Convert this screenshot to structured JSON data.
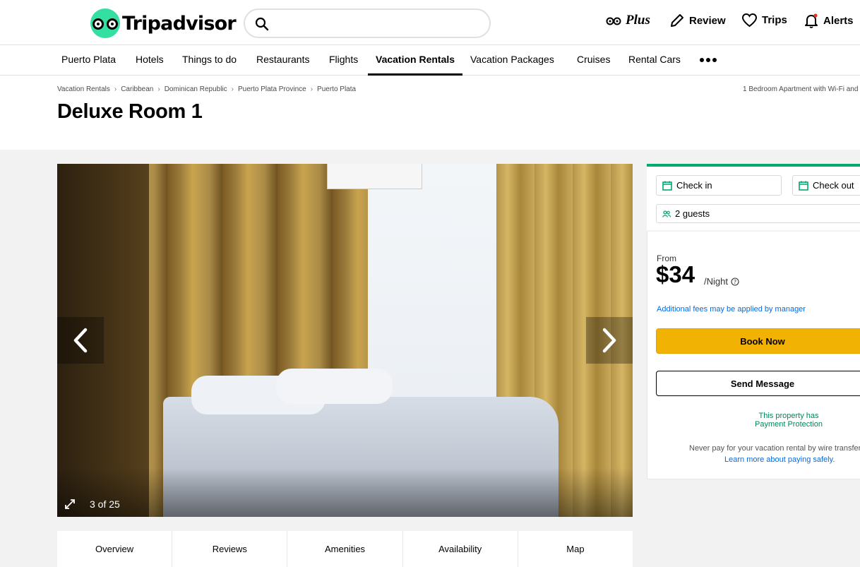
{
  "header": {
    "brand": "Tripadvisor",
    "search": {
      "placeholder": "",
      "value": ""
    },
    "plus_label": "Plus",
    "nav": [
      {
        "label": "Review",
        "icon": "pencil-icon"
      },
      {
        "label": "Trips",
        "icon": "heart-icon"
      },
      {
        "label": "Alerts",
        "icon": "bell-icon"
      }
    ]
  },
  "categories": {
    "items": [
      "Puerto Plata",
      "Hotels",
      "Things to do",
      "Restaurants",
      "Flights",
      "Vacation Rentals",
      "Vacation Packages",
      "Cruises",
      "Rental Cars"
    ],
    "active": "Vacation Rentals"
  },
  "breadcrumb": {
    "items": [
      "Vacation Rentals",
      "Caribbean",
      "Dominican Republic",
      "Puerto Plata Province",
      "Puerto Plata"
    ],
    "right_text": "1 Bedroom Apartment with Wi-Fi and"
  },
  "listing": {
    "title": "Deluxe Room 1",
    "photo_counter": "3 of 25"
  },
  "tabs": [
    "Overview",
    "Reviews",
    "Amenities",
    "Availability",
    "Map"
  ],
  "booking": {
    "check_in": "Check in",
    "check_out": "Check out",
    "guests": "2 guests",
    "from_label": "From",
    "price": "$34",
    "per_night": "/Night",
    "fees_note": "Additional fees may be applied by manager",
    "book_now": "Book Now",
    "send_message": "Send Message",
    "protection_line1": "This property has",
    "protection_line2": "Payment Protection",
    "never_pay": "Never pay for your vacation rental by wire transfer.",
    "learn_more": "Learn more about paying safely."
  },
  "colors": {
    "brand_green": "#34e0a1",
    "accent_green": "#00aa6c",
    "book_yellow": "#f2b203",
    "link_blue": "#066be0"
  }
}
